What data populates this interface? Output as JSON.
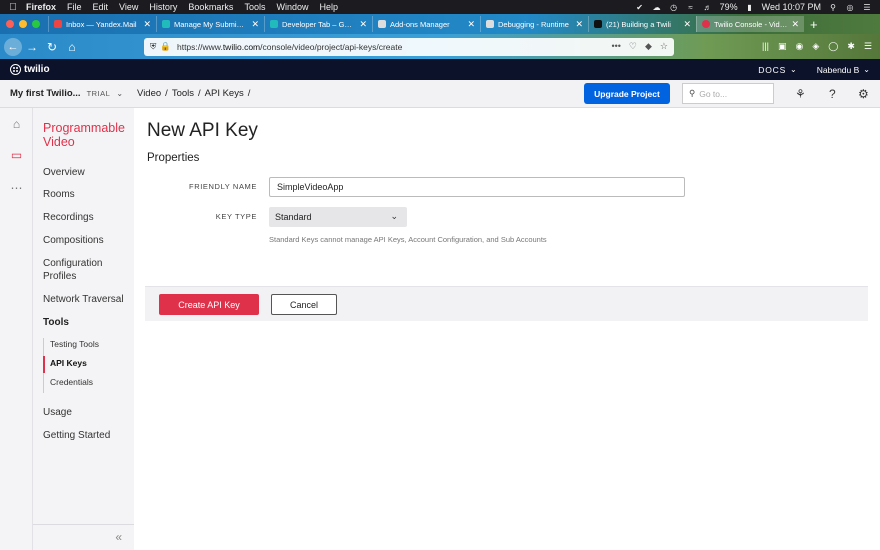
{
  "menubar": {
    "app": "Firefox",
    "items": [
      "File",
      "Edit",
      "View",
      "History",
      "Bookmarks",
      "Tools",
      "Window",
      "Help"
    ],
    "battery": "79%",
    "clock": "Wed 10:07 PM"
  },
  "tabs": [
    {
      "title": "Inbox — Yandex.Mail",
      "favicon_color": "#e44"
    },
    {
      "title": "Manage My Submissio",
      "favicon_color": "#2bb"
    },
    {
      "title": "Developer Tab – Get th",
      "favicon_color": "#2bb"
    },
    {
      "title": "Add-ons Manager",
      "favicon_color": "#ddd"
    },
    {
      "title": "Debugging - Runtime",
      "favicon_color": "#ddd"
    },
    {
      "title": "(21) Building a Twili",
      "favicon_color": "#111"
    },
    {
      "title": "Twilio Console - Video",
      "favicon_color": "#e0314b"
    }
  ],
  "urlbar": {
    "url_prefix": "https://www.",
    "url_domain": "twilio.com",
    "url_path": "/console/video/project/api-keys/create"
  },
  "twilio": {
    "logo": "twilio",
    "docs": "DOCS",
    "user": "Nabendu B"
  },
  "project": {
    "name": "My first Twilio...",
    "trial": "TRIAL",
    "breadcrumb": [
      "Video",
      "/",
      "Tools",
      "/",
      "API Keys",
      "/"
    ],
    "upgrade_label": "Upgrade Project",
    "goto_placeholder": "Go to..."
  },
  "sidebar": {
    "title": "Programmable Video",
    "items": [
      "Overview",
      "Rooms",
      "Recordings",
      "Compositions",
      "Configuration Profiles",
      "Network Traversal",
      "Tools"
    ],
    "subitems": [
      "Testing Tools",
      "API Keys",
      "Credentials"
    ],
    "bottom_items": [
      "Usage",
      "Getting Started"
    ]
  },
  "form": {
    "title": "New API Key",
    "section": "Properties",
    "friendly_name_label": "FRIENDLY NAME",
    "friendly_name_value": "SimpleVideoApp",
    "key_type_label": "KEY TYPE",
    "key_type_value": "Standard",
    "help_text": "Standard Keys cannot manage API Keys, Account Configuration, and Sub Accounts",
    "create_label": "Create API Key",
    "cancel_label": "Cancel"
  },
  "colors": {
    "twilio_red": "#e0314b",
    "twilio_navy": "#0d122b",
    "upgrade_blue": "#0263e0"
  }
}
